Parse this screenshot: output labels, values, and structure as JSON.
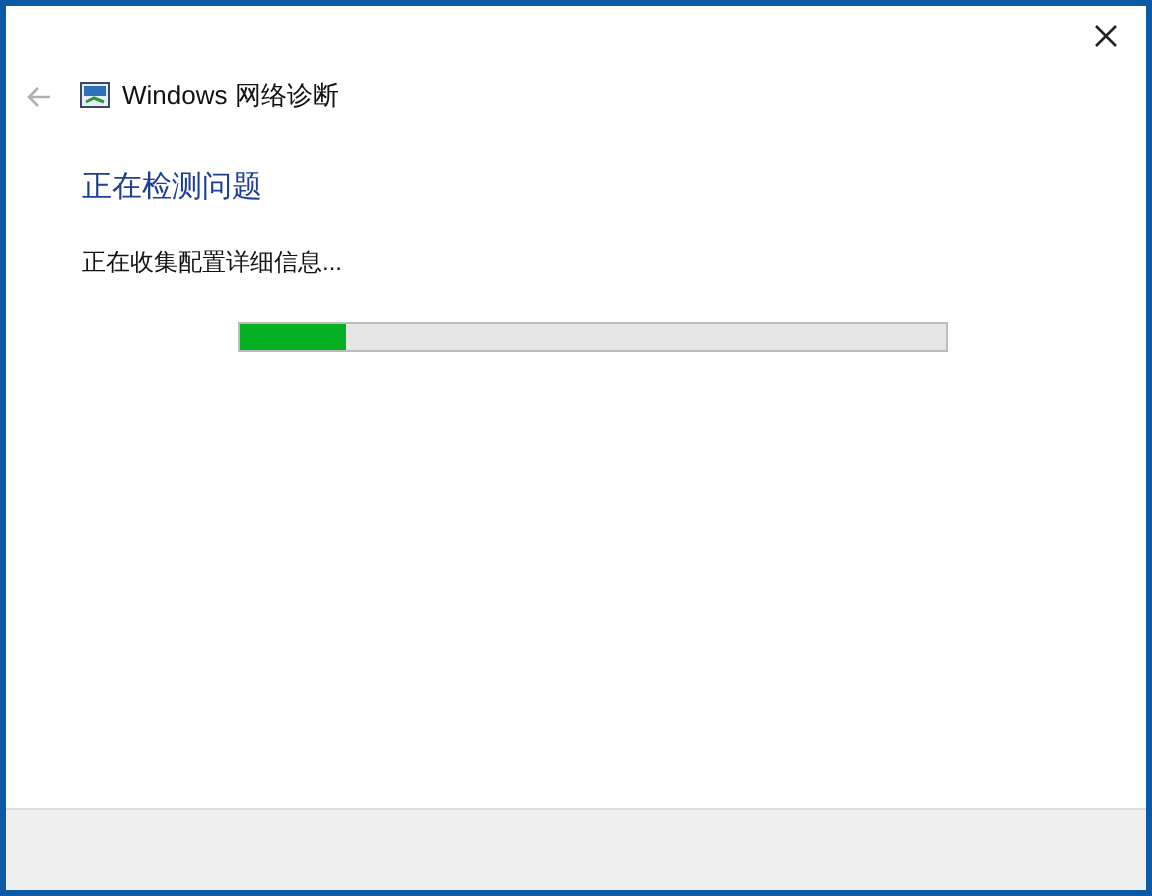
{
  "window": {
    "title": "Windows 网络诊断"
  },
  "heading": "正在检测问题",
  "status": "正在收集配置详细信息...",
  "progress": {
    "level": 0.15
  }
}
